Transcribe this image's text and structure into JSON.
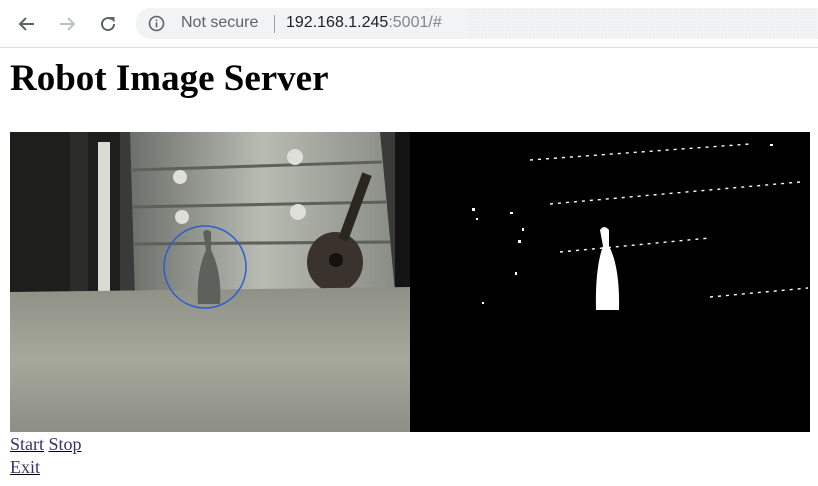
{
  "browser": {
    "security_label": "Not secure",
    "url_host": "192.168.1.245",
    "url_rest": ":5001/#"
  },
  "page": {
    "title": "Robot Image Server",
    "links": {
      "start": "Start",
      "stop": "Stop",
      "exit": "Exit"
    }
  },
  "colors": {
    "detection_circle": "#2a5fcf",
    "link": "#3c2f6e"
  }
}
